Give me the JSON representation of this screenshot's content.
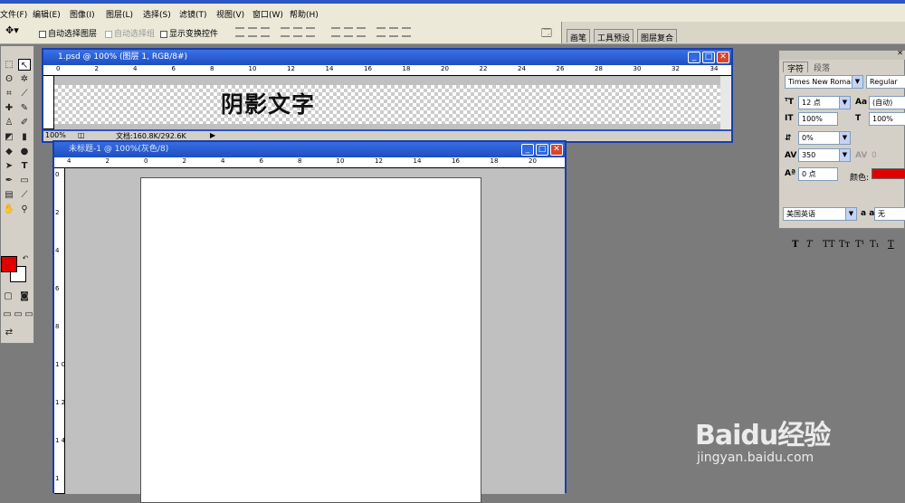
{
  "menu": {
    "file": "文件(F)",
    "edit": "编辑(E)",
    "image": "图像(I)",
    "layer": "图层(L)",
    "select": "选择(S)",
    "filter": "滤镜(T)",
    "view": "视图(V)",
    "window": "窗口(W)",
    "help": "帮助(H)"
  },
  "options": {
    "auto_select_layer": "自动选择图层",
    "auto_select_group": "自动选择组",
    "show_transform": "显示变换控件"
  },
  "well_tabs": {
    "brushes": "画笔",
    "tool_presets": "工具预设",
    "layer_comps": "图层复合"
  },
  "doc1": {
    "title": "1.psd @ 100% (图层 1, RGB/8#)",
    "text": "阴影文字",
    "zoom": "100%",
    "doc_size": "文档:160.8K/292.6K",
    "ruler": [
      "0",
      "2",
      "4",
      "6",
      "8",
      "10",
      "12",
      "14",
      "16",
      "18",
      "20",
      "22",
      "24",
      "26",
      "28",
      "30",
      "32",
      "34"
    ]
  },
  "doc2": {
    "title": "未标题-1 @ 100%(灰色/8)",
    "ruler_h": [
      "4",
      "2",
      "0",
      "2",
      "4",
      "6",
      "8",
      "10",
      "12",
      "14",
      "16",
      "18",
      "20"
    ],
    "ruler_v": [
      "0",
      "2",
      "4",
      "6",
      "8",
      "1 0",
      "1 2",
      "1 4",
      "1"
    ]
  },
  "char_panel": {
    "tab_char": "字符",
    "tab_para": "段落",
    "font": "Times New Roman",
    "style": "Regular",
    "size": "12 点",
    "leading": "(自动)",
    "vscale": "100%",
    "hscale": "100%",
    "tracking": "0%",
    "kerning": "350",
    "kern2": "0",
    "baseline": "0 点",
    "color_label": "颜色:",
    "language": "美国英语",
    "aa": "无",
    "aa_label": "a a"
  },
  "watermark": {
    "brand": "Baidu经验",
    "url": "jingyan.baidu.com"
  },
  "colors": {
    "fg": "#e00000",
    "title": "#2953c6",
    "panel_color": "#e00000"
  }
}
